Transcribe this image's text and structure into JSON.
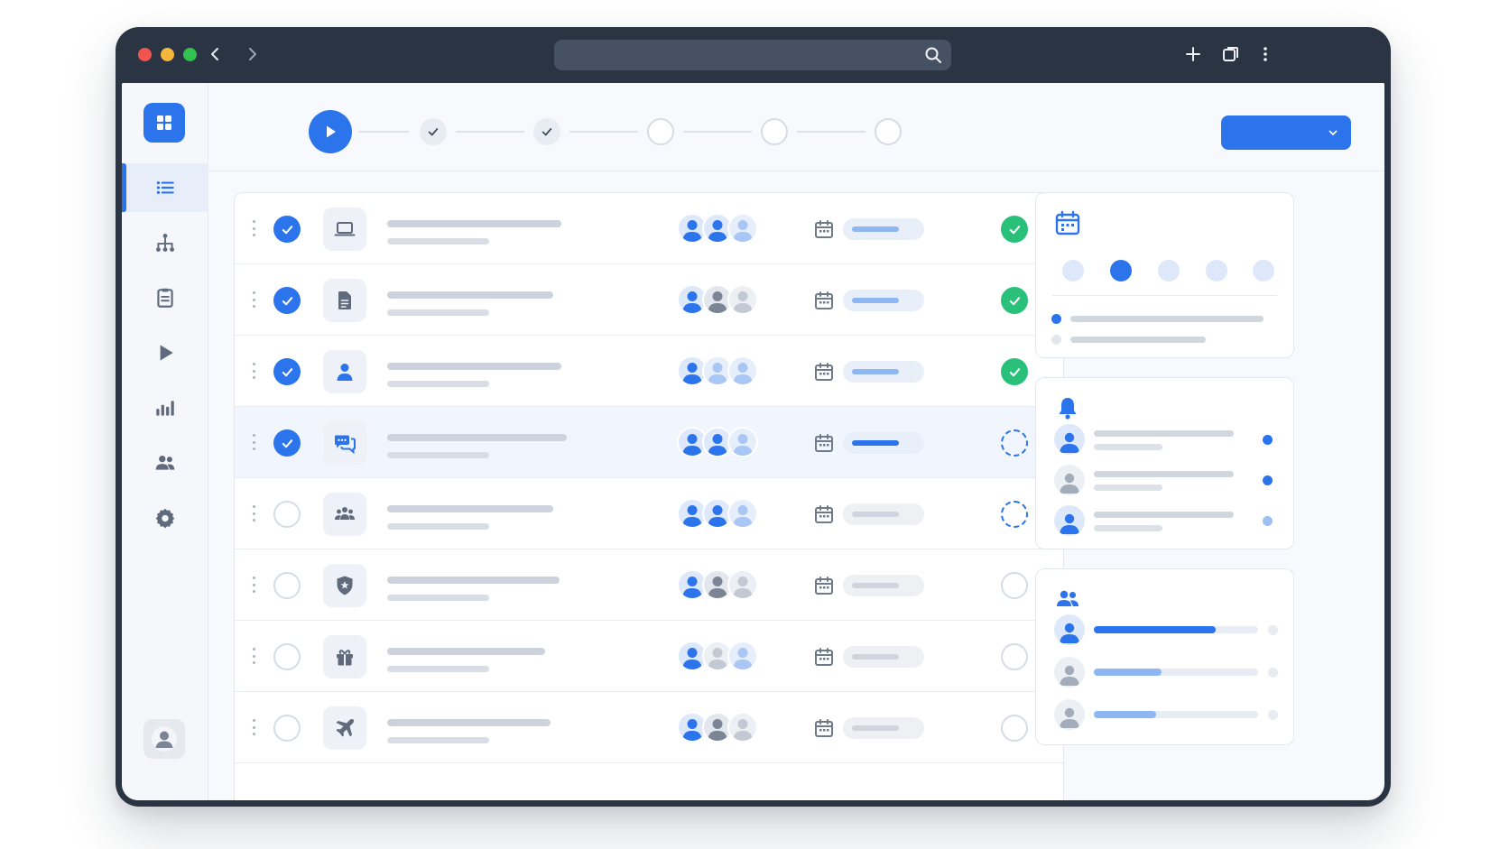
{
  "window": {
    "controls": [
      "close",
      "minimize",
      "maximize"
    ]
  },
  "toolbar": {
    "back_icon": "chevron-left-icon",
    "forward_icon": "chevron-right-icon",
    "search_placeholder": "",
    "right_icons": [
      "plus-icon",
      "tabs-icon",
      "more-vertical-icon"
    ]
  },
  "sidebar": {
    "logo_icon": "grid-icon",
    "items": [
      {
        "icon": "list-icon",
        "active": true
      },
      {
        "icon": "hierarchy-icon",
        "active": false
      },
      {
        "icon": "clipboard-icon",
        "active": false
      },
      {
        "icon": "play-icon",
        "active": false
      },
      {
        "icon": "bar-chart-icon",
        "active": false
      },
      {
        "icon": "users-icon",
        "active": false
      },
      {
        "icon": "gear-icon",
        "active": false
      }
    ],
    "bottom": "user-avatar-icon"
  },
  "stepper": {
    "current": "play-icon",
    "steps": [
      "done",
      "done",
      "pending",
      "pending",
      "pending"
    ]
  },
  "primary_action": {
    "label": "",
    "icon": "chevron-down-icon"
  },
  "tasks": [
    {
      "title": "",
      "subtitle": "",
      "checked": true,
      "type_icon": "laptop-icon",
      "status": "done",
      "selected": false
    },
    {
      "title": "",
      "subtitle": "",
      "checked": true,
      "type_icon": "document-icon",
      "status": "done",
      "selected": false
    },
    {
      "title": "",
      "subtitle": "",
      "checked": true,
      "type_icon": "user-icon",
      "status": "done",
      "selected": false
    },
    {
      "title": "",
      "subtitle": "",
      "checked": true,
      "type_icon": "chat-icon",
      "status": "in-progress",
      "selected": true
    },
    {
      "title": "",
      "subtitle": "",
      "checked": false,
      "type_icon": "team-icon",
      "status": "in-progress",
      "selected": false
    },
    {
      "title": "",
      "subtitle": "",
      "checked": false,
      "type_icon": "shield-icon",
      "status": "todo",
      "selected": false
    },
    {
      "title": "",
      "subtitle": "",
      "checked": false,
      "type_icon": "gift-icon",
      "status": "todo",
      "selected": false
    },
    {
      "title": "",
      "subtitle": "",
      "checked": false,
      "type_icon": "airplane-icon",
      "status": "todo",
      "selected": false
    }
  ],
  "calendar_card": {
    "icon": "calendar-icon",
    "active_day_index": 1
  },
  "notifications_card": {
    "icon": "bell-icon"
  },
  "team_card": {
    "icon": "users-icon",
    "progress": [
      0.74,
      0.41,
      0.38
    ]
  },
  "colors": {
    "accent": "#2b74eb",
    "success": "#29c17a",
    "chrome": "#2a3443"
  }
}
